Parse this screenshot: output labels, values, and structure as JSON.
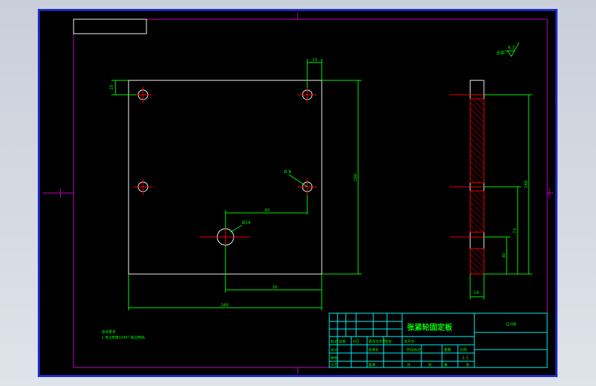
{
  "drawing": {
    "title": "张紧轮固定板",
    "code": "Q-08",
    "roughness_label": "全部",
    "roughness_value": "6.3",
    "scale": "1:1",
    "material": "",
    "notes": [
      "技术要求",
      "1.未注倒角1X45°,锐边倒钝。"
    ]
  },
  "dimensions": {
    "top_width": "10",
    "top_left_offset": "10",
    "height": "180",
    "width": "160",
    "horizontal_offset": "65",
    "bottom_offset": "30",
    "small_hole": "Ø 8",
    "large_hole": "Ø14",
    "side_thickness": "14",
    "side_height_full": "160",
    "side_height_mid": "73",
    "side_height_low": "30"
  },
  "title_block": {
    "cells": [
      "标记",
      "处数",
      "分区",
      "更改文件号",
      "签名",
      "年月日",
      "设计",
      "标准化",
      "审核",
      "工艺",
      "批准",
      "阶段标记",
      "重量",
      "比例",
      "共",
      "张",
      "第",
      "张"
    ]
  },
  "colors": {
    "frame": "#cc00cc",
    "outline": "#ffffff",
    "dimension": "#00ff00",
    "center": "#ff0000",
    "hatch": "#ff0000",
    "table": "#00ffff",
    "text_green": "#00ff00",
    "viewport_border": "#1e2bd0"
  }
}
